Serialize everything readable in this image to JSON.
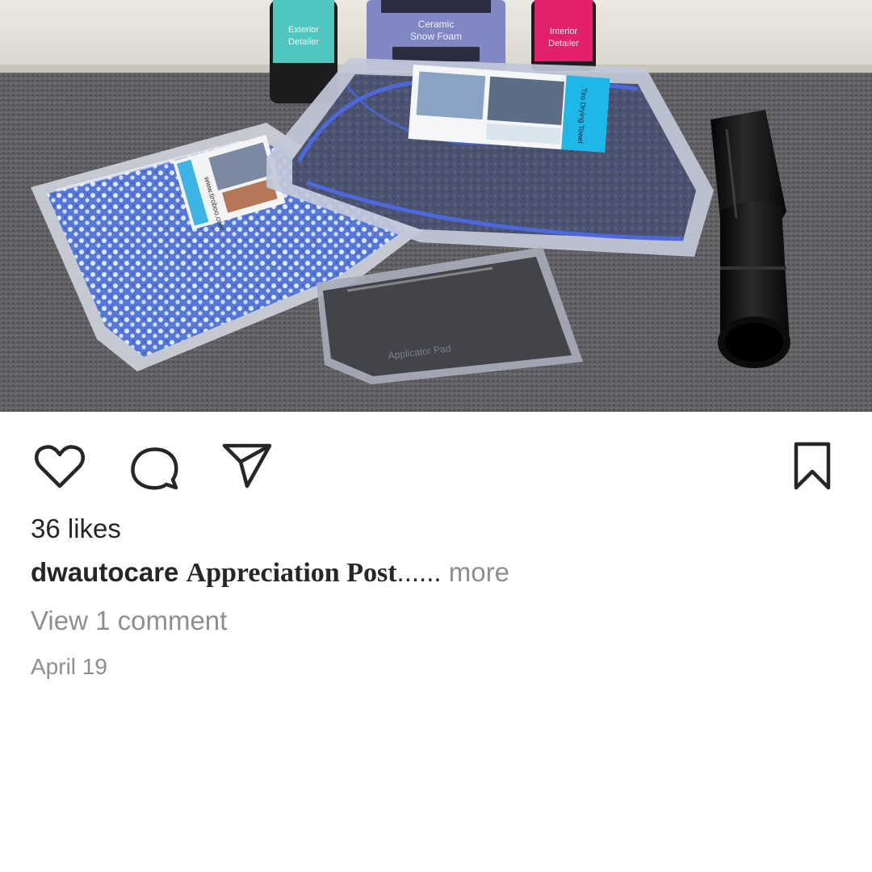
{
  "post": {
    "likes": "36 likes",
    "username": "dwautocare",
    "caption": "Appreciation Post",
    "ellipsis": "......",
    "more": "more",
    "view_comments": "View 1 comment",
    "date": "April 19"
  },
  "photo": {
    "bottle_labels": [
      [
        "Exterior",
        "Detailer"
      ],
      [
        "Ceramic",
        "Snow Foam"
      ],
      [
        "Interior",
        "Detailer"
      ]
    ],
    "towel_label": "Tiro Drying Towel",
    "wash_mitt_label": "www.tiroboo.com",
    "pad_label": "Applicator Pad"
  },
  "icons": {
    "like": "heart-icon",
    "comment": "speech-bubble-icon",
    "share": "paper-plane-icon",
    "save": "bookmark-icon"
  },
  "colors": {
    "text": "#262626",
    "muted": "#8e8e8e",
    "background": "#ffffff"
  }
}
